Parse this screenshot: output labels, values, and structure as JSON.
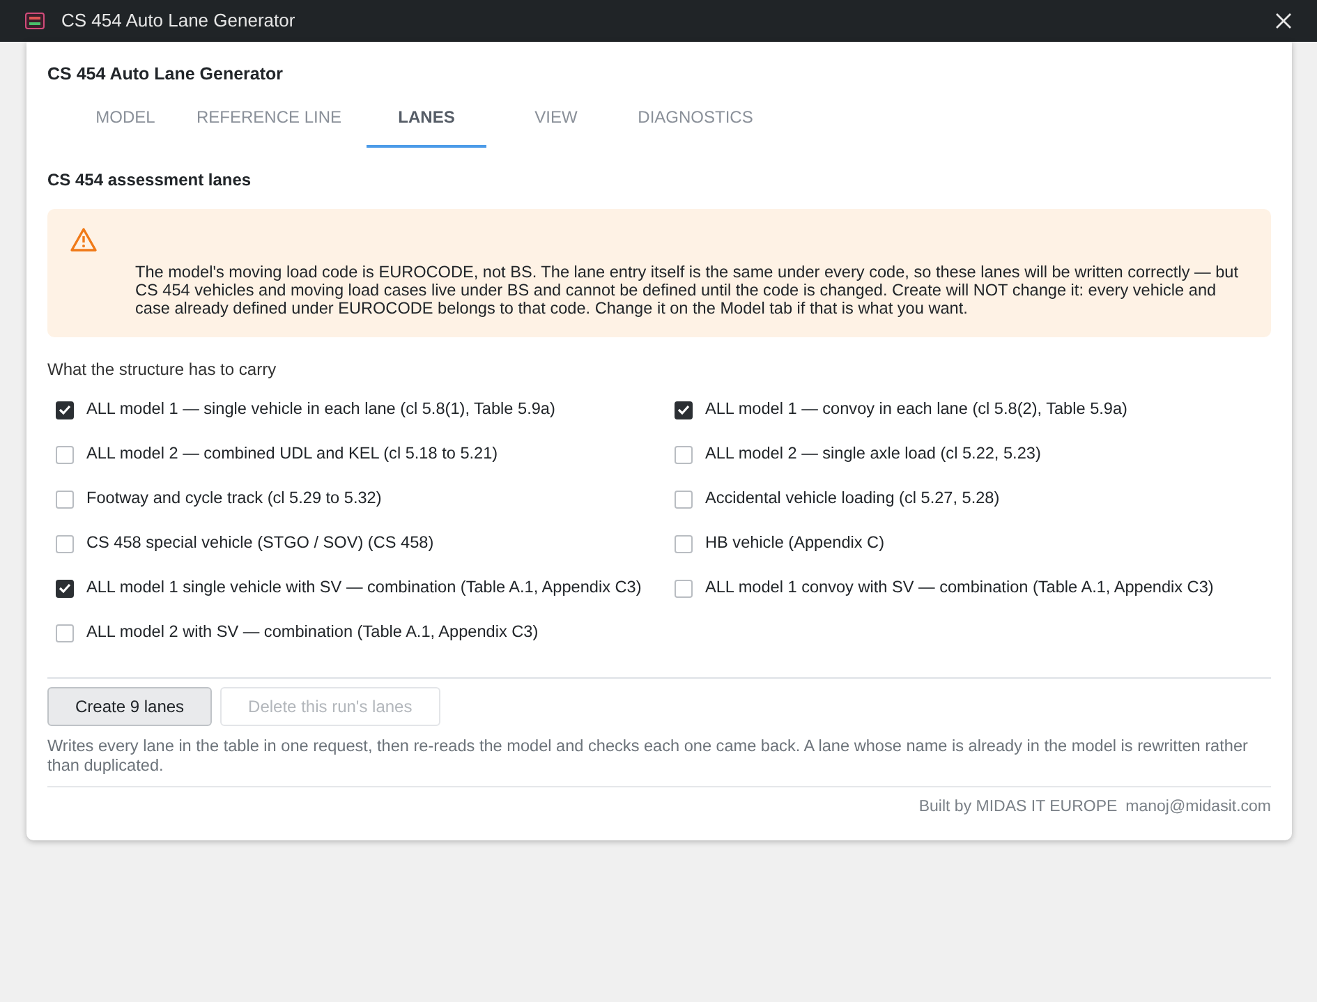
{
  "window": {
    "title": "CS 454 Auto Lane Generator"
  },
  "app_title": "CS 454 Auto Lane Generator",
  "tabs": [
    {
      "label": "MODEL",
      "selected": false
    },
    {
      "label": "REFERENCE LINE",
      "selected": false
    },
    {
      "label": "LANES",
      "selected": true
    },
    {
      "label": "VIEW",
      "selected": false
    },
    {
      "label": "DIAGNOSTICS",
      "selected": false
    }
  ],
  "section_title": "CS 454 assessment lanes",
  "warning": {
    "text": "The model's moving load code is EUROCODE, not BS. The lane entry itself is the same under every code, so these lanes will be written correctly — but CS 454 vehicles and moving load cases live under BS and cannot be defined until the code is changed. Create will NOT change it: every vehicle and case already defined under EUROCODE belongs to that code. Change it on the Model tab if that is what you want."
  },
  "loads_label": "What the structure has to carry",
  "loads": [
    {
      "label": "ALL model 1 — single vehicle in each lane (cl 5.8(1), Table 5.9a)",
      "checked": true
    },
    {
      "label": "ALL model 1 — convoy in each lane (cl 5.8(2), Table 5.9a)",
      "checked": true
    },
    {
      "label": "ALL model 2 — combined UDL and KEL (cl 5.18 to 5.21)",
      "checked": false
    },
    {
      "label": "ALL model 2 — single axle load (cl 5.22, 5.23)",
      "checked": false
    },
    {
      "label": "Footway and cycle track (cl 5.29 to 5.32)",
      "checked": false
    },
    {
      "label": "Accidental vehicle loading (cl 5.27, 5.28)",
      "checked": false
    },
    {
      "label": "CS 458 special vehicle (STGO / SOV) (CS 458)",
      "checked": false
    },
    {
      "label": "HB vehicle (Appendix C)",
      "checked": false
    },
    {
      "label": "ALL model 1 single vehicle with SV — combination (Table A.1, Appendix C3)",
      "checked": true
    },
    {
      "label": "ALL model 1 convoy with SV — combination (Table A.1, Appendix C3)",
      "checked": false
    },
    {
      "label": "ALL model 2 with SV — combination (Table A.1, Appendix C3)",
      "checked": false
    }
  ],
  "actions": [
    {
      "label": "Create 9 lanes",
      "disabled": false
    },
    {
      "label": "Delete this run's lanes",
      "disabled": true
    }
  ],
  "help_text": "Writes every lane in the table in one request, then re-reads the model and checks each one came back. A lane whose name is already in the model is rewritten rather than duplicated.",
  "footer": {
    "credit": "Built by MIDAS IT EUROPE",
    "email": "manoj@midasit.com"
  }
}
